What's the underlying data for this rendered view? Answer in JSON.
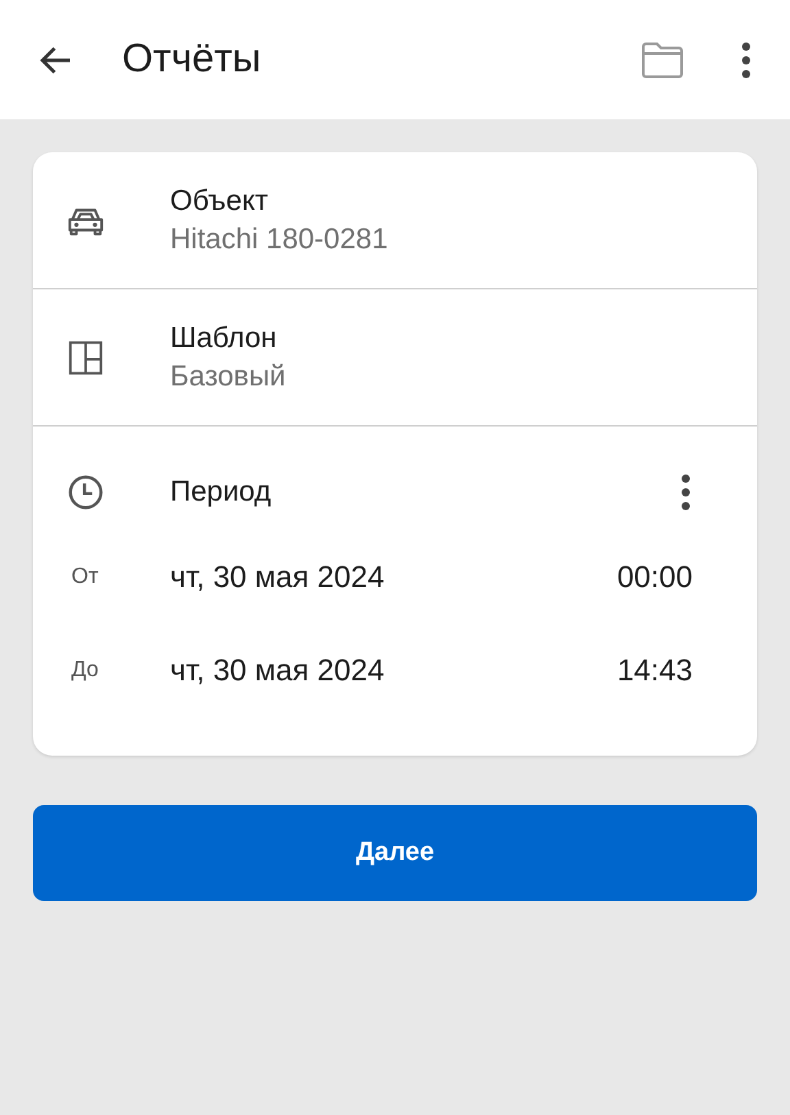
{
  "app_bar": {
    "title": "Отчёты"
  },
  "fields": [
    {
      "kind": "car",
      "label": "Объект",
      "value": "Hitachi 180-0281"
    },
    {
      "kind": "template",
      "label": "Шаблон",
      "value": "Базовый"
    }
  ],
  "period": {
    "label": "Период",
    "rows": [
      {
        "prefix": "От",
        "date": "чт, 30 мая 2024",
        "time": "00:00"
      },
      {
        "prefix": "До",
        "date": "чт, 30 мая 2024",
        "time": "14:43"
      }
    ]
  },
  "next_button": {
    "label": "Далее"
  }
}
